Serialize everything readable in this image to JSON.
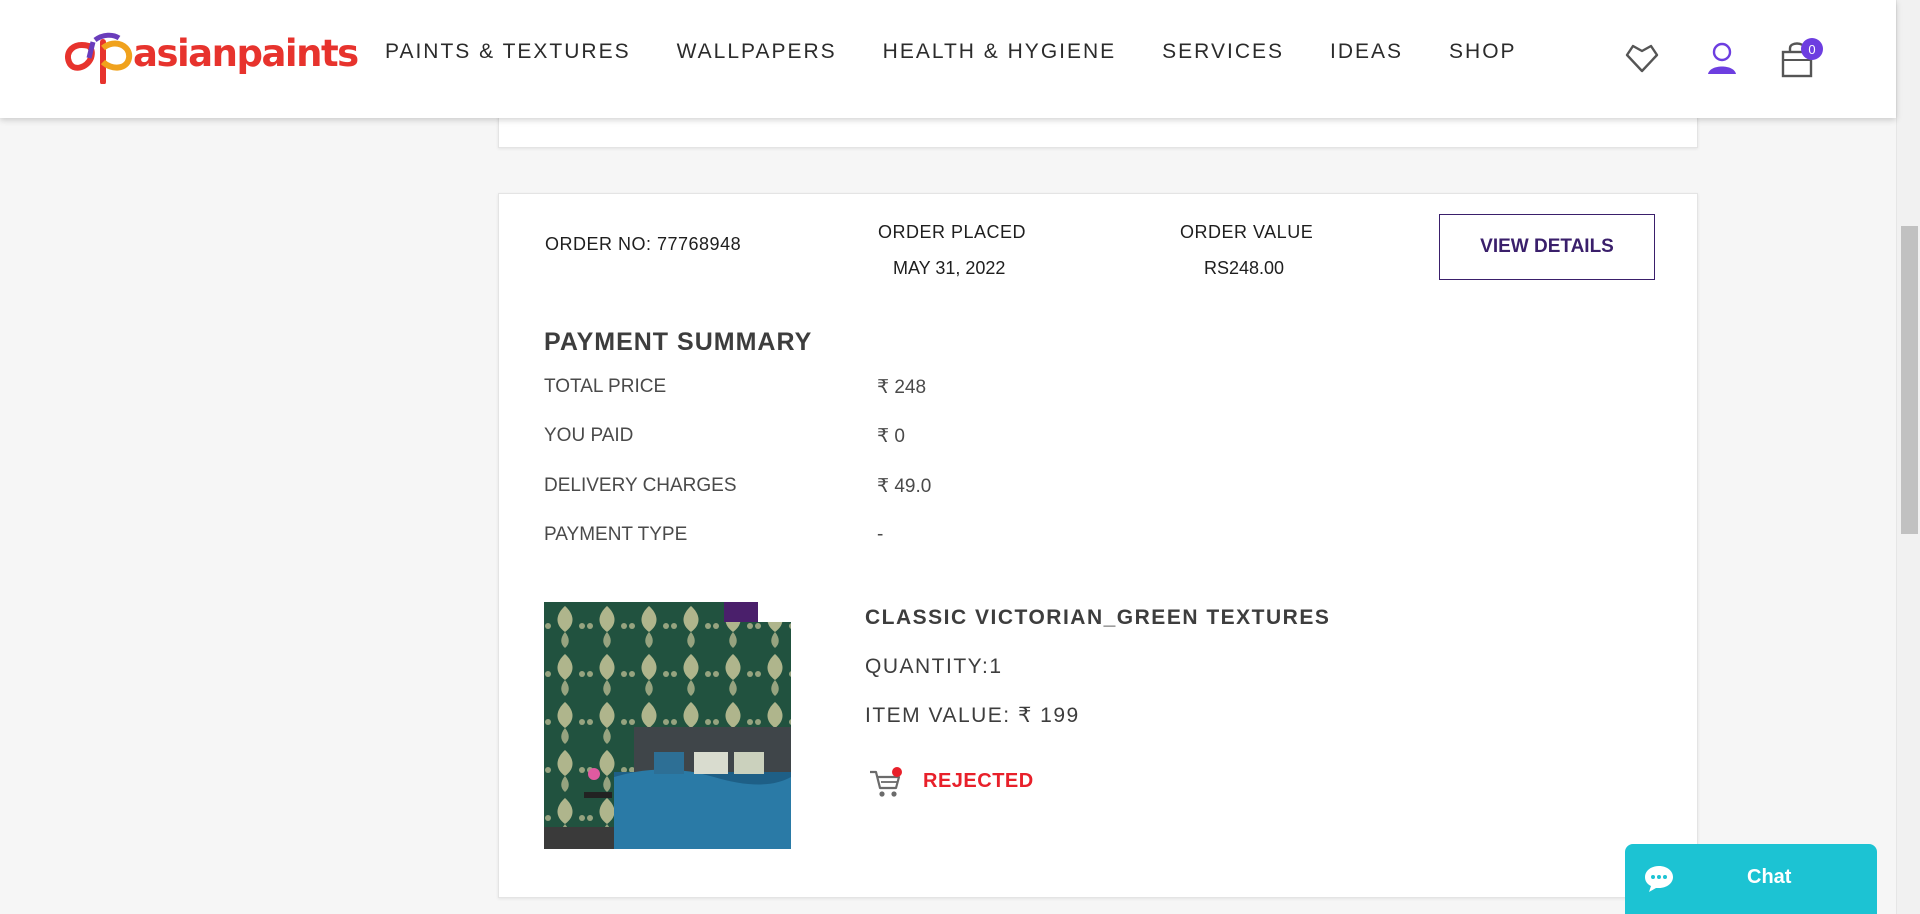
{
  "brand": {
    "name": "asianpaints"
  },
  "nav": {
    "items": [
      {
        "label": "PAINTS & TEXTURES"
      },
      {
        "label": "WALLPAPERS"
      },
      {
        "label": "HEALTH & HYGIENE"
      },
      {
        "label": "SERVICES"
      },
      {
        "label": "IDEAS"
      },
      {
        "label": "SHOP"
      }
    ]
  },
  "header_icons": {
    "wishlist": "heart-icon",
    "account": "user-icon",
    "cart": "shopping-bag-icon",
    "cart_count": "0"
  },
  "order": {
    "order_no_label": "ORDER NO: 77768948",
    "placed_label": "ORDER PLACED",
    "placed_date": "MAY 31, 2022",
    "value_label": "ORDER VALUE",
    "value": "RS248.00",
    "view_details": "VIEW DETAILS"
  },
  "payment_summary": {
    "title": "PAYMENT SUMMARY",
    "rows": [
      {
        "label": "TOTAL PRICE",
        "value": "₹ 248"
      },
      {
        "label": "YOU PAID",
        "value": "₹ 0"
      },
      {
        "label": "DELIVERY CHARGES",
        "value": "₹ 49.0"
      },
      {
        "label": "PAYMENT TYPE",
        "value": "-"
      }
    ]
  },
  "item": {
    "name": "CLASSIC VICTORIAN_GREEN TEXTURES",
    "quantity": "QUANTITY:1",
    "value": "ITEM VALUE: ₹ 199",
    "status": "REJECTED",
    "status_icon": "cart-icon"
  },
  "chat": {
    "label": "Chat"
  },
  "colors": {
    "brand_red": "#e7332d",
    "accent_purple": "#3a1f6b",
    "status_rejected": "#e8202a",
    "chat_teal": "#1cc3d3",
    "badge_purple": "#6d3ee0"
  }
}
